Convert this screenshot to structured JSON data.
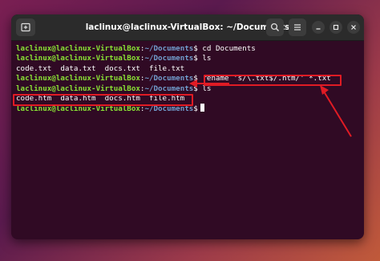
{
  "window": {
    "title": "laclinux@laclinux-VirtualBox: ~/Documents"
  },
  "terminal": {
    "prompt_user": "laclinux@laclinux-VirtualBox",
    "prompt_path": "~/Documents",
    "prompt_symbol": "$",
    "lines": [
      {
        "type": "prompt",
        "command": "cd Documents"
      },
      {
        "type": "prompt",
        "command": "ls"
      },
      {
        "type": "output",
        "text": "code.txt  data.txt  docs.txt  file.txt"
      },
      {
        "type": "prompt",
        "command": "rename 's/\\.txt$/.htm/' *.txt"
      },
      {
        "type": "prompt",
        "command": "ls"
      },
      {
        "type": "output",
        "text": "code.htm  data.htm  docs.htm  file.htm"
      },
      {
        "type": "prompt",
        "command": ""
      }
    ]
  },
  "icons": {
    "new_tab": "new-tab-icon",
    "search": "search-icon",
    "menu": "hamburger-menu-icon",
    "minimize": "minimize-icon",
    "maximize": "maximize-icon",
    "close": "close-icon"
  },
  "colors": {
    "terminal_bg": "#300a24",
    "titlebar_bg": "#2b2b2b",
    "prompt_user": "#8ae234",
    "prompt_path": "#729fcf",
    "highlight": "#e01b24"
  }
}
